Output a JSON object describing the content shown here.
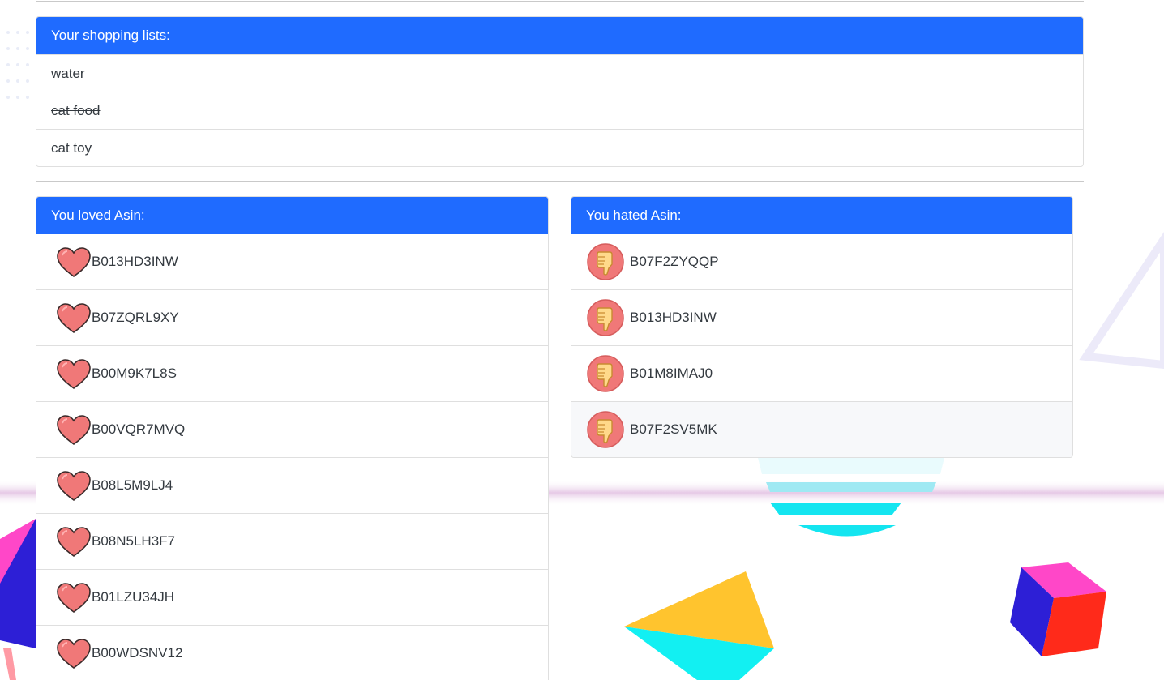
{
  "shopping": {
    "header": "Your shopping lists:",
    "items": [
      {
        "label": "water",
        "done": false
      },
      {
        "label": "cat food",
        "done": true
      },
      {
        "label": "cat toy",
        "done": false
      }
    ]
  },
  "loved": {
    "header": "You loved Asin:",
    "icon": "heart-icon",
    "items": [
      "B013HD3INW",
      "B07ZQRL9XY",
      "B00M9K7L8S",
      "B00VQR7MVQ",
      "B08L5M9LJ4",
      "B08N5LH3F7",
      "B01LZU34JH",
      "B00WDSNV12"
    ]
  },
  "hated": {
    "header": "You hated Asin:",
    "icon": "thumbs-down-icon",
    "items": [
      "B07F2ZYQQP",
      "B013HD3INW",
      "B01M8IMAJ0",
      "B07F2SV5MK"
    ]
  },
  "colors": {
    "header_bg": "#1f6bff",
    "header_text": "#ffffff",
    "heart_fill": "#f07878",
    "thumb_circle": "#f07878",
    "thumb_hand": "#ffd98a"
  }
}
